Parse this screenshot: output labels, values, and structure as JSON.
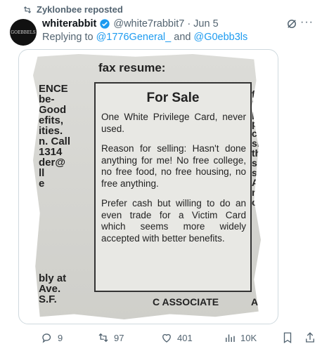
{
  "repost": {
    "label": "Zyklonbee reposted"
  },
  "post": {
    "display_name": "whiterabbit",
    "handle": "@white7rabbit7",
    "separator": "·",
    "date": "Jun 5",
    "replying_prefix": "Replying to",
    "reply_to_1": "@1776General_",
    "reply_and": "and",
    "reply_to_2": "@G0ebb3ls",
    "avatar_text": "GOEBBELS"
  },
  "image": {
    "header": "fax resume:",
    "ad_title": "For Sale",
    "ad_p1": "One White Privilege Card, never used.",
    "ad_p2": "Reason for selling: Hasn't done anything for me! No free college, no free food, no free housing, no free anything.",
    "ad_p3": "Prefer cash but willing to do an even trade for a Victim Card which seems more widely accepted with better benefits.",
    "left_fragments": [
      "ENCE",
      "be-",
      "Good",
      "efits,",
      "ities.",
      "n. Call",
      "1314",
      "der@",
      "ll",
      "e",
      "",
      "",
      "",
      "",
      "",
      "",
      "",
      "",
      "bly at",
      "Ave.",
      "S.F."
    ],
    "right_fragments": [
      "fo",
      "Re",
      "pa",
      "pres",
      "cleri",
      "shel",
      "the",
      "subr",
      "sala",
      "Attn",
      "nb",
      "o"
    ],
    "assoc": "C ASSOCIATE",
    "bottom_right": "As"
  },
  "actions": {
    "replies": "9",
    "reposts": "97",
    "likes": "401",
    "views": "10K"
  },
  "colors": {
    "accent": "#1d9bf0",
    "muted": "#536471",
    "repost_green": "#536471"
  }
}
